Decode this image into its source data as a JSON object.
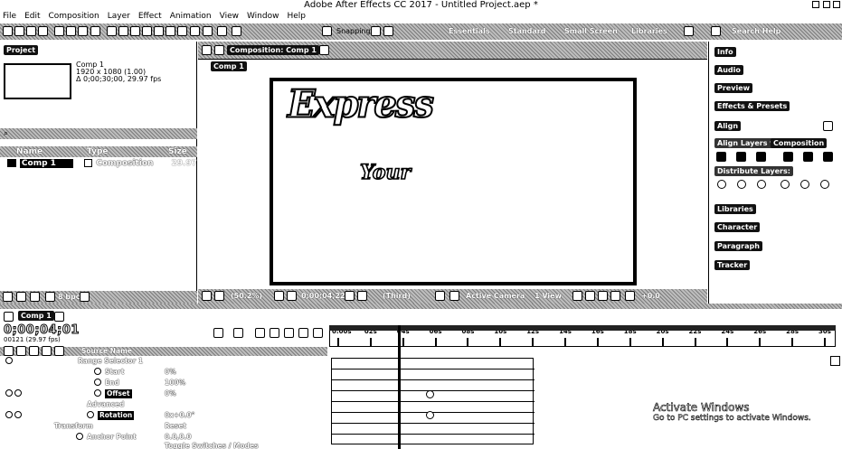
{
  "titlebar": {
    "title": "Adobe After Effects CC 2017 - Untitled Project.aep *"
  },
  "menu": [
    "File",
    "Edit",
    "Composition",
    "Layer",
    "Effect",
    "Animation",
    "View",
    "Window",
    "Help"
  ],
  "toolbar": {
    "snapping": "Snapping",
    "workspaces": [
      "Essentials",
      "Standard",
      "Small Screen",
      "Libraries"
    ],
    "search_help": "Search Help"
  },
  "project": {
    "tab": "Project",
    "comp_name": "Comp 1",
    "comp_size": "1920 x 1080 (1.00)",
    "comp_duration": "Δ 0;00;30;00, 29.97 fps",
    "columns": [
      "Name",
      "Type",
      "Size"
    ],
    "items": [
      {
        "name": "Comp 1",
        "type": "Composition",
        "size": "29.97"
      }
    ],
    "footer_bpc": "8 bpc"
  },
  "composition": {
    "tab": "Composition: Comp 1",
    "breadcrumb": "Comp 1",
    "text_express": "Express",
    "text_your": "Your",
    "zoom": "(50.2%)",
    "timecode": "0;00;04;22",
    "resolution": "(Third)",
    "camera": "Active Camera",
    "view": "1 View",
    "exposure": "+0.0"
  },
  "right_panel": {
    "items": [
      "Info",
      "Audio",
      "Preview",
      "Effects & Presets",
      "Align"
    ],
    "align_layers_to": "Align Layers to:",
    "align_target": "Composition",
    "distribute": "Distribute Layers:",
    "bottom_items": [
      "Libraries",
      "Character",
      "Paragraph",
      "Tracker"
    ]
  },
  "timeline": {
    "tab": "Comp 1",
    "timecode": "0;00;04;01",
    "fps": "00121 (29.97 fps)",
    "source_col": "Source Name",
    "ruler": [
      "0:00s",
      "02s",
      "04s",
      "06s",
      "08s",
      "10s",
      "12s",
      "14s",
      "16s",
      "18s",
      "20s",
      "22s",
      "24s",
      "26s",
      "28s",
      "30s"
    ],
    "props": [
      {
        "label": "Range Selector 1",
        "value": ""
      },
      {
        "label": "Start",
        "value": "0%"
      },
      {
        "label": "End",
        "value": "100%"
      },
      {
        "label": "Offset",
        "value": "0%"
      },
      {
        "label": "Advanced",
        "value": ""
      },
      {
        "label": "Rotation",
        "value": "0x+0.0°"
      },
      {
        "label": "Transform",
        "value": "Reset"
      },
      {
        "label": "Anchor Point",
        "value": "0.0,0.0"
      }
    ],
    "toggle": "Toggle Switches / Modes"
  },
  "watermark": {
    "title": "Activate Windows",
    "subtitle": "Go to PC settings to activate Windows."
  }
}
